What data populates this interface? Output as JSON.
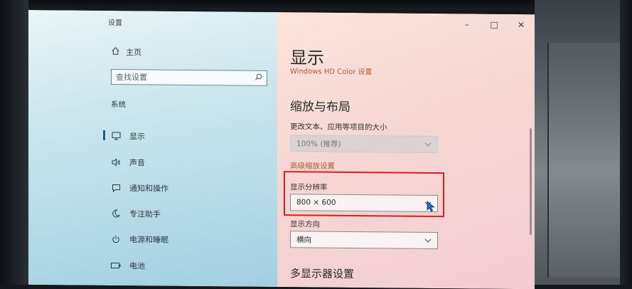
{
  "window": {
    "title": "设置",
    "controls": [
      "–",
      "□",
      "✕"
    ]
  },
  "sidebar": {
    "home_label": "主页",
    "search_placeholder": "查找设置",
    "section_label": "系统",
    "items": [
      {
        "label": "显示",
        "icon": "monitor-icon",
        "selected": true
      },
      {
        "label": "声音",
        "icon": "speaker-icon"
      },
      {
        "label": "通知和操作",
        "icon": "notification-icon"
      },
      {
        "label": "专注助手",
        "icon": "moon-icon"
      },
      {
        "label": "电源和睡眠",
        "icon": "power-icon"
      },
      {
        "label": "电池",
        "icon": "battery-icon"
      }
    ]
  },
  "main": {
    "page_title": "显示",
    "hd_color_link": "Windows HD Color 设置",
    "scale_section_title": "缩放与布局",
    "scale_label": "更改文本、应用等项目的大小",
    "scale_value": "100% (推荐)",
    "advanced_scale_link": "高级缩放设置",
    "resolution_label": "显示分辨率",
    "resolution_value": "800 × 600",
    "orientation_label": "显示方向",
    "orientation_value": "横向",
    "multi_display_title": "多显示器设置"
  },
  "colors": {
    "accent_link": "#b35a2a",
    "highlight_box": "#d61f1f",
    "cursor": "#1a6fd8"
  }
}
